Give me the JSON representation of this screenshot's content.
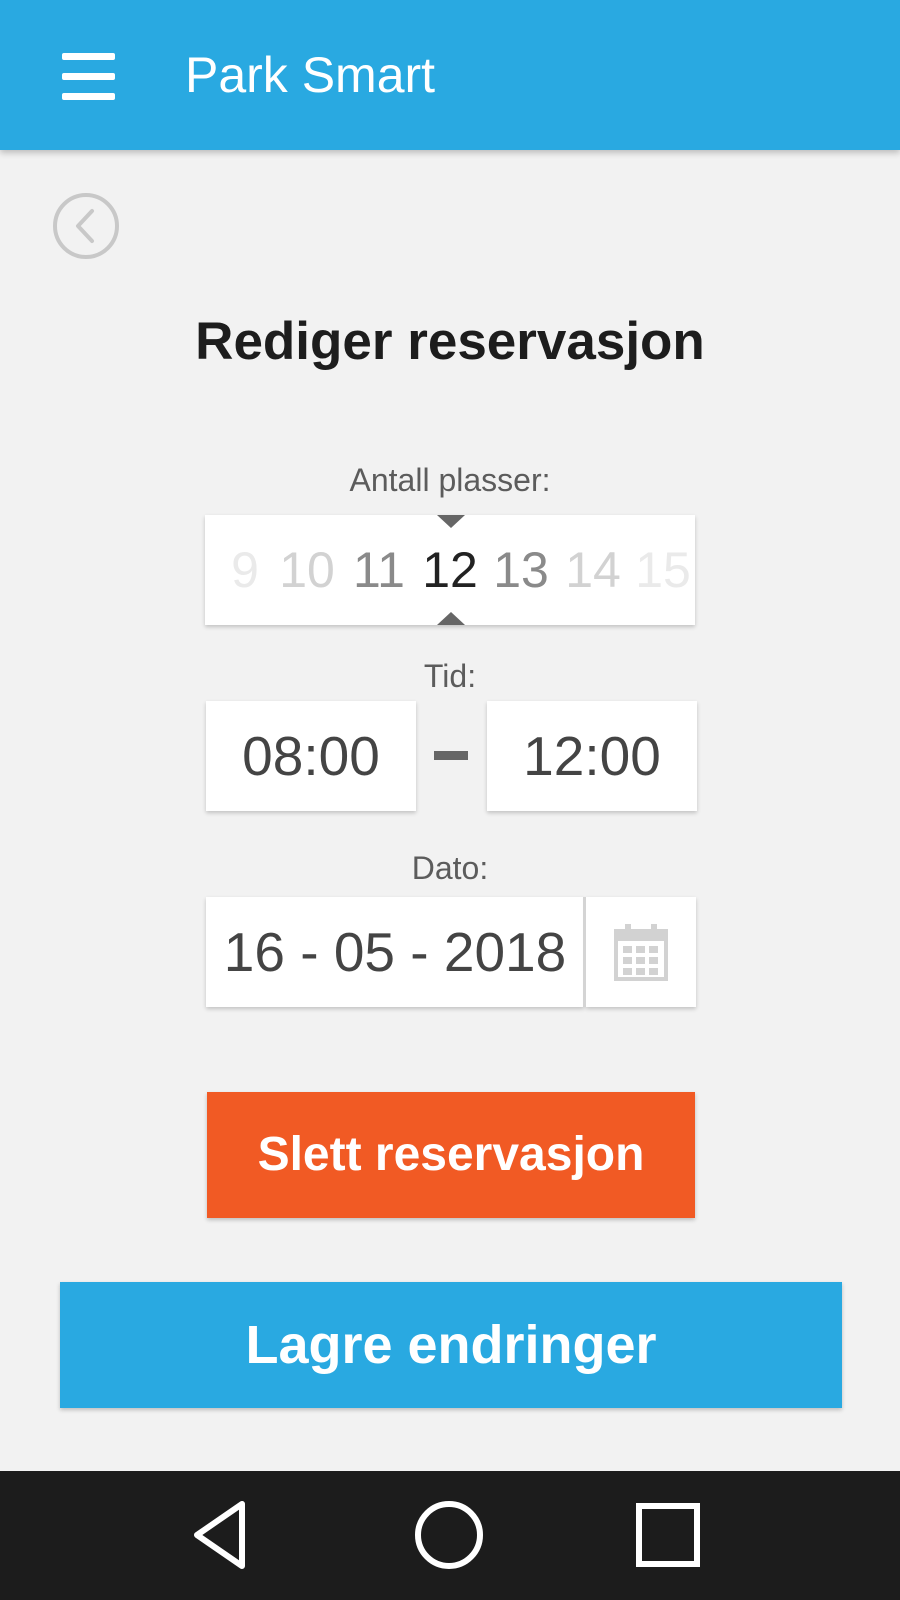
{
  "app_bar": {
    "title": "Park Smart",
    "menu_icon": "hamburger-menu-icon",
    "background_color": "#29a9e1"
  },
  "back_icon": "chevron-left-circle-icon",
  "page_title": "Rediger reservasjon",
  "spots": {
    "label": "Antall plasser:",
    "options": [
      "9",
      "10",
      "11",
      "12",
      "13",
      "14",
      "15"
    ],
    "selected": "12"
  },
  "time": {
    "label": "Tid:",
    "start": "08:00",
    "end": "12:00"
  },
  "date": {
    "label": "Dato:",
    "value": "16 - 05 - 2018",
    "calendar_icon": "calendar-icon"
  },
  "actions": {
    "delete_label": "Slett reservasjon",
    "delete_color": "#f15a24",
    "save_label": "Lagre endringer",
    "save_color": "#29a9e1"
  },
  "nav_bar": {
    "back_icon": "triangle-back-icon",
    "home_icon": "circle-home-icon",
    "recents_icon": "square-recents-icon"
  }
}
